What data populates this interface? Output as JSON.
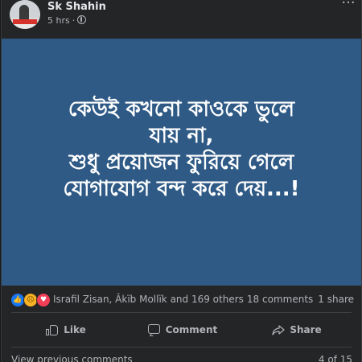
{
  "post": {
    "author_name": "Sk Shahin",
    "timestamp": "5 hrs",
    "separator": "·",
    "privacy_icon": "globe-icon",
    "more_icon": "more-options-icon",
    "more_glyph": "···"
  },
  "image": {
    "background_color": "#2f5a86",
    "text_lines": [
      "কেউই কখনো কাওকে ভুলে",
      "যায় না,",
      "শুধু প্রয়োজন ফুরিয়ে গেলে",
      "যোগাযোগ বন্দ করে দেয়...!"
    ]
  },
  "reactions": {
    "icons": [
      "like-reaction-icon",
      "sad-reaction-icon",
      "love-reaction-icon"
    ],
    "names": "Israfil Zisan, Âkïb Mollïk and 169 others",
    "comments": "18 comments",
    "shares": "1 share"
  },
  "actions": {
    "like_label": "Like",
    "comment_label": "Comment",
    "share_label": "Share"
  },
  "comments": {
    "view_previous": "View previous comments",
    "page_count": "4 of 15"
  },
  "colors": {
    "card_background": "#242526",
    "page_background": "#18191a",
    "secondary_text": "#b0b3b8",
    "like_blue": "#1877f2",
    "love_red": "#f33e58",
    "sad_yellow": "#f7b125"
  }
}
